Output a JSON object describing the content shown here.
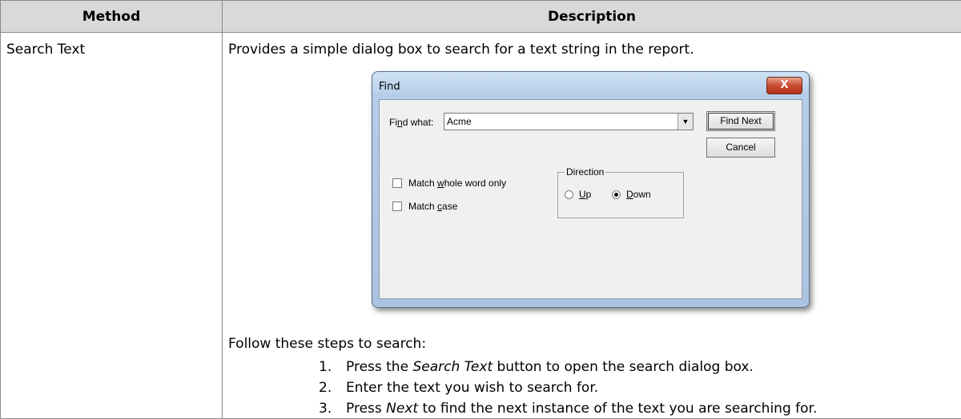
{
  "table": {
    "headers": {
      "method": "Method",
      "description": "Description"
    },
    "row": {
      "method": "Search Text",
      "description_intro": "Provides a simple dialog box to search for a text string in the report.",
      "follow_text": "Follow these steps to search:",
      "steps": [
        {
          "num": "1.",
          "pre": "Press the ",
          "em": "Search Text",
          "post": " button to open the search dialog box."
        },
        {
          "num": "2.",
          "pre": "Enter the text you wish to search for.",
          "em": "",
          "post": ""
        },
        {
          "num": "3.",
          "pre": "Press ",
          "em": "Next",
          "post": " to find the next instance of the text you are searching for."
        }
      ]
    }
  },
  "dialog": {
    "title": "Find",
    "close_glyph": "X",
    "find_label_pre": "Fi",
    "find_label_u": "n",
    "find_label_post": "d what:",
    "find_value": "Acme",
    "dropdown_icon": "▼",
    "find_next_label": "Find Next",
    "cancel_label": "Cancel",
    "whole_word_pre": "Match ",
    "whole_word_u": "w",
    "whole_word_post": "hole word only",
    "match_case_pre": "Match ",
    "match_case_u": "c",
    "match_case_post": "ase",
    "direction_label": "Direction",
    "up_u": "U",
    "up_post": "p",
    "down_u": "D",
    "down_post": "own",
    "selected_direction": "Down",
    "match_whole_word": false,
    "match_case": false
  }
}
